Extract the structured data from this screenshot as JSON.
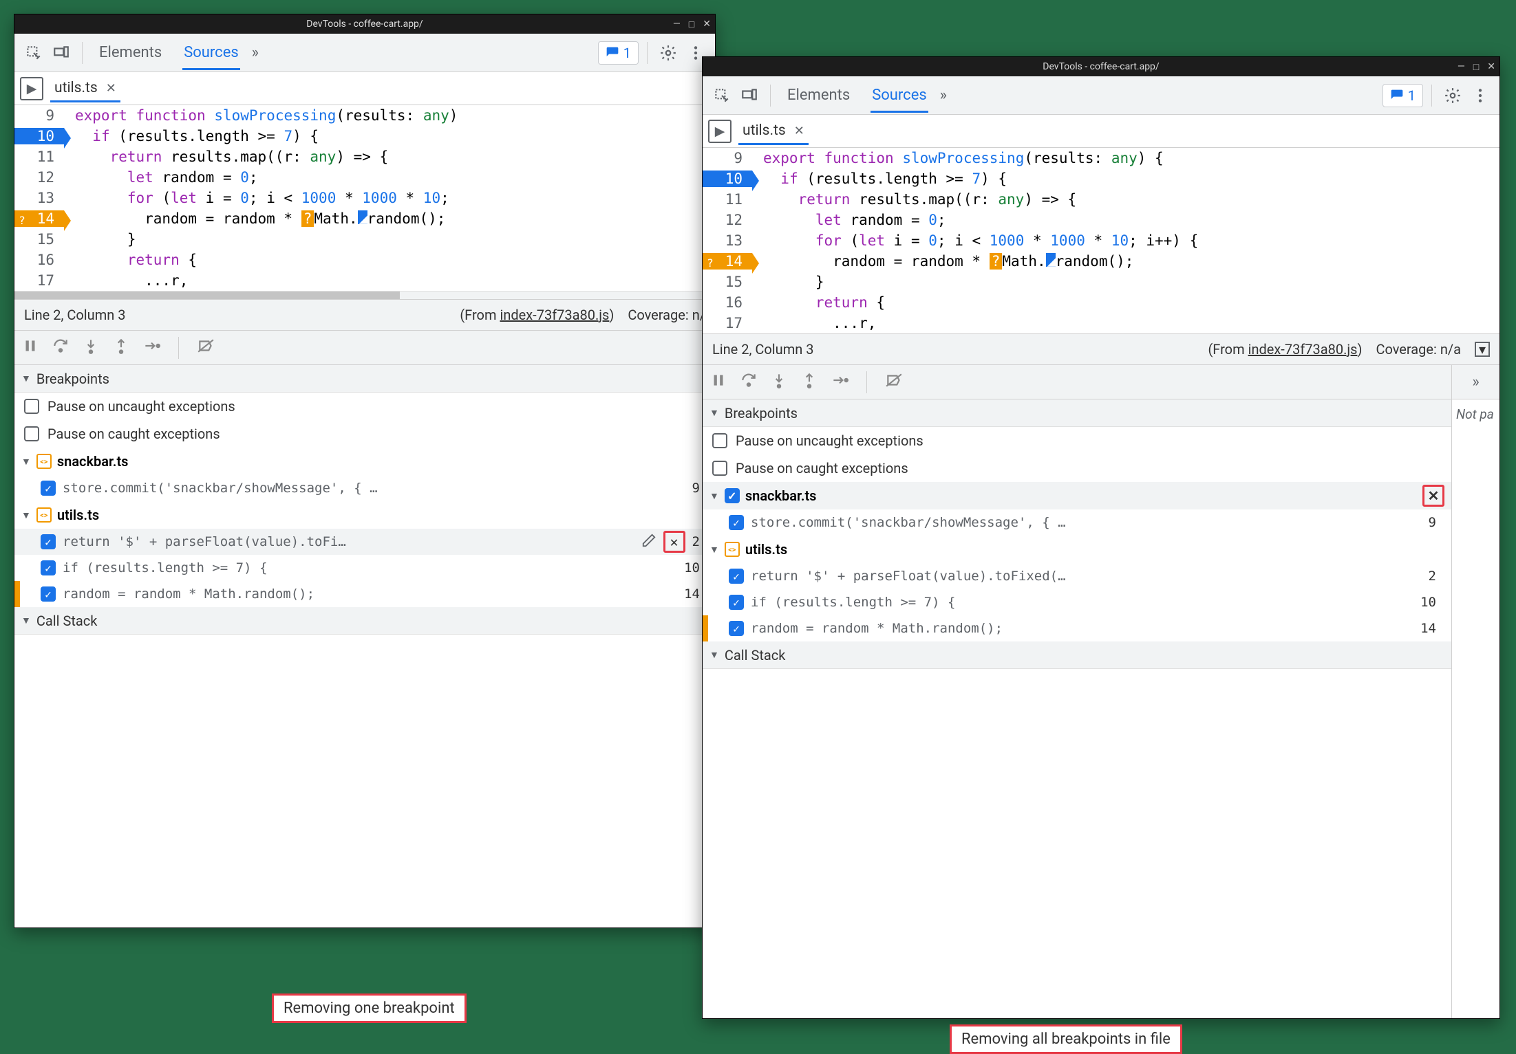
{
  "caption_left": "Removing one breakpoint",
  "caption_right": "Removing all breakpoints in file",
  "window": {
    "title": "DevTools - coffee-cart.app/",
    "tabs": {
      "elements": "Elements",
      "sources": "Sources"
    },
    "msg_count": "1",
    "filetab": "utils.ts",
    "status": {
      "pos": "Line 2, Column 3",
      "from_label": "(From ",
      "from_file": "index-73f73a80.js",
      "from_close": ")",
      "coverage_left": "Coverage: n/",
      "coverage_right": "Coverage: n/a"
    },
    "code": {
      "l9": "export function slowProcessing(results: any) {",
      "l9_r": "export function slowProcessing(results: any) {",
      "l10": "  if (results.length >= 7) {",
      "l11": "    return results.map((r: any) => {",
      "l12": "      let random = 0;",
      "l13_left": "      for (let i = 0; i < 1000 * 1000 * 10;",
      "l13_right": "      for (let i = 0; i < 1000 * 1000 * 10; i++) {",
      "l14a": "        random = random * ",
      "l14b": "Math.",
      "l14c": "random();",
      "l15": "      }",
      "l16": "      return {",
      "l17": "        ...r,"
    },
    "sections": {
      "breakpoints": "Breakpoints",
      "callstack": "Call Stack",
      "pause_uncaught": "Pause on uncaught exceptions",
      "pause_caught": "Pause on caught exceptions"
    },
    "bp_files": {
      "snackbar": "snackbar.ts",
      "utils": "utils.ts"
    },
    "bp_lines": {
      "snack1": {
        "txt": "store.commit('snackbar/showMessage', { …",
        "ln": "9"
      },
      "util1_left": {
        "txt": "return '$' + parseFloat(value).toFi…",
        "ln": "2"
      },
      "util1_right": {
        "txt": "return '$' + parseFloat(value).toFixed(…",
        "ln": "2"
      },
      "util2": {
        "txt": "if (results.length >= 7) {",
        "ln": "10"
      },
      "util3": {
        "txt": "random = random * Math.random();",
        "ln": "14"
      }
    },
    "side_text": "Not pa"
  }
}
